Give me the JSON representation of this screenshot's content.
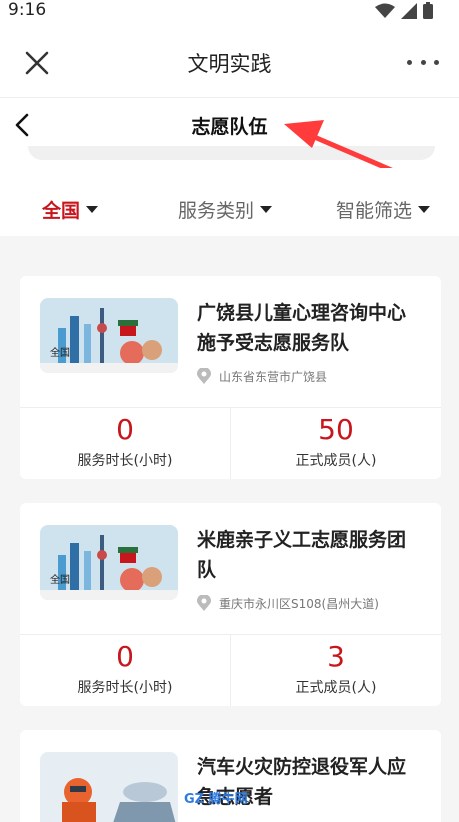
{
  "status": {
    "time": "9:16"
  },
  "appbar": {
    "title": "文明实践"
  },
  "page": {
    "title": "志愿队伍"
  },
  "filters": [
    {
      "label": "全国",
      "active": true
    },
    {
      "label": "服务类别",
      "active": false
    },
    {
      "label": "智能筛选",
      "active": false
    }
  ],
  "cards": [
    {
      "name_lines": [
        "广饶县儿童心理咨询中心",
        "施予受志愿服务队"
      ],
      "location": "山东省东营市广饶县",
      "stats": [
        {
          "value": "0",
          "label": "服务时长(小时)"
        },
        {
          "value": "50",
          "label": "正式成员(人)"
        }
      ],
      "thumb_text": "全国"
    },
    {
      "name_lines": [
        "米鹿亲子义工志愿服务团",
        "队"
      ],
      "location": "重庆市永川区S108(昌州大道)",
      "stats": [
        {
          "value": "0",
          "label": "服务时长(小时)"
        },
        {
          "value": "3",
          "label": "正式成员(人)"
        }
      ],
      "thumb_text": "全国"
    },
    {
      "name_lines": [
        "汽车火灾防控退役军人应",
        "急志愿者"
      ],
      "location": "",
      "stats": [],
      "thumb_text": ""
    }
  ],
  "watermark": "GZ 腾牛网",
  "colors": {
    "accent": "#c8161d",
    "text": "#222222",
    "bg": "#f5f5f5"
  },
  "icons": [
    "wifi-icon",
    "signal-icon",
    "battery-icon",
    "close-icon",
    "more-icon",
    "back-icon",
    "location-pin-icon",
    "dropdown-triangle-icon"
  ]
}
